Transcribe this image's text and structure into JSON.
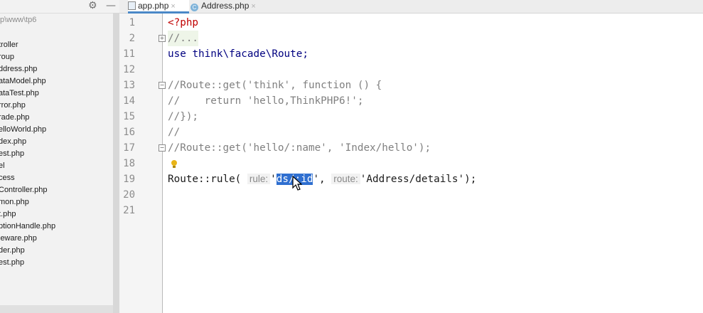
{
  "sidebar": {
    "path": "p\\www\\tp6",
    "files": [
      "troller",
      "roup",
      "ddress.php",
      "ataModel.php",
      "ataTest.php",
      "rror.php",
      "rade.php",
      "elloWorld.php",
      "dex.php",
      "est.php",
      "el",
      "cess",
      "Controller.php",
      "mon.php",
      "t.php",
      "ptionHandle.php",
      "leware.php",
      "der.php",
      "est.php"
    ]
  },
  "tabs": [
    {
      "label": "app.php",
      "close": "×"
    },
    {
      "label": "Address.php",
      "close": "×"
    }
  ],
  "icons": {
    "settings": "gear-icon",
    "minimize": "minimize-icon",
    "bulb": "lightbulb-icon",
    "cursor": "mouse-pointer-icon"
  },
  "editor": {
    "line_numbers": [
      "1",
      "2",
      "11",
      "12",
      "13",
      "14",
      "15",
      "16",
      "17",
      "18",
      "19",
      "20",
      "21"
    ],
    "lines": {
      "l1": "<?php",
      "l2": "//...",
      "l11_kw": "use ",
      "l11_rest": "think\\facade\\Route;",
      "l13": "//Route::get('think', function () {",
      "l14": "//    return 'hello,ThinkPHP6!';",
      "l15": "//});",
      "l16": "//",
      "l17": "//Route::get('hello/:name', 'Index/hello');",
      "l19_a": "Route::rule(",
      "l19_hint1": "rule:",
      "l19_q1": "'",
      "l19_sel": "ds/:id",
      "l19_q2": "',",
      "l19_hint2": "route:",
      "l19_b": "'Address/details');"
    }
  },
  "colors": {
    "selection": "#2f6fd0",
    "php_tag": "#c00000",
    "keyword": "#000080",
    "comment": "#808080",
    "tab_underline": "#4a88c7"
  }
}
